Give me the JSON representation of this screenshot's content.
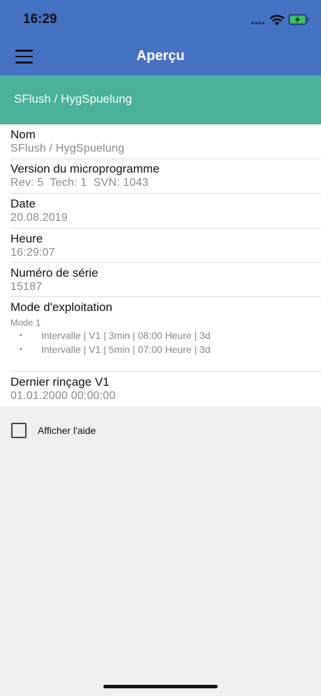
{
  "status_bar": {
    "time": "16:29",
    "icons": [
      "signal-icon",
      "wifi-icon",
      "battery-charging-icon"
    ],
    "battery_color": "#3cc35a"
  },
  "nav": {
    "title": "Aperçu",
    "menu_icon": "hamburger-menu-icon",
    "background": "#4672c4"
  },
  "device": {
    "name": "SFlush / HygSpuelung",
    "background": "#4ab19a"
  },
  "info": {
    "name_label": "Nom",
    "name_value": "SFlush / HygSpuelung",
    "firmware_label": "Version du microprogramme",
    "firmware_value": "Rev: 5  Tech: 1  SVN: 1043",
    "date_label": "Date",
    "date_value": "20.08.2019",
    "time_label": "Heure",
    "time_value": "16:29:07",
    "serial_label": "Numéro de série",
    "serial_value": "15187",
    "mode_label": "Mode d'exploitation",
    "mode_value": "Mode 1",
    "mode_items": [
      "Intervalle | V1 | 3min | 08:00 Heure | 3d",
      "Intervalle | V1 | 5min | 07:00 Heure | 3d"
    ],
    "last_flush_label": "Dernier rinçage V1",
    "last_flush_value": "01.01.2000 00:00:00"
  },
  "help": {
    "label": "Afficher l'aide",
    "checked": false
  }
}
